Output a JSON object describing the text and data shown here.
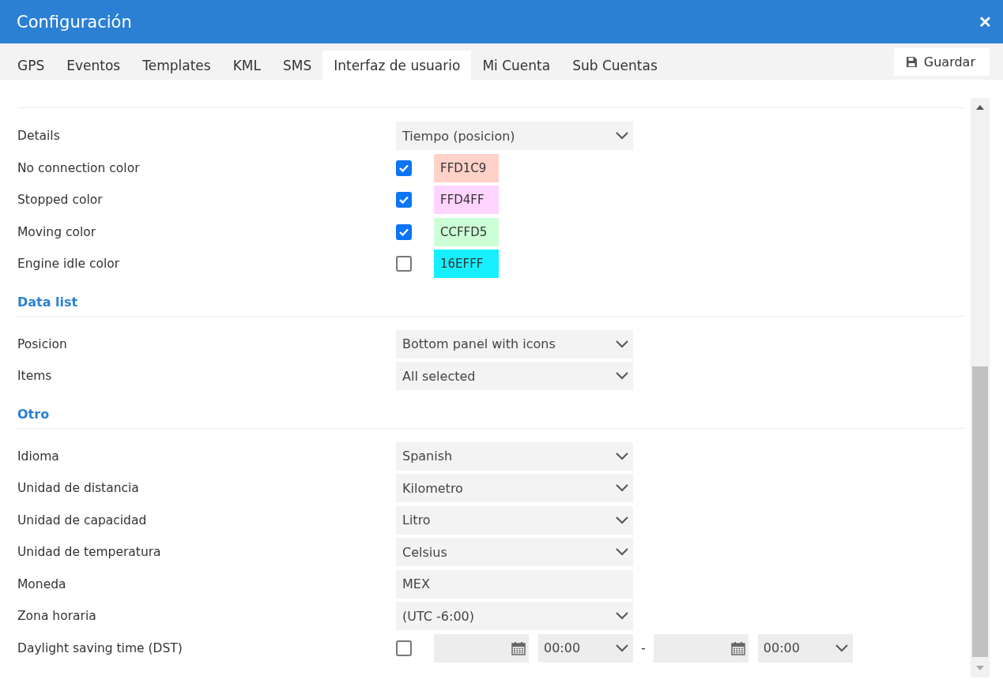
{
  "window": {
    "title": "Configuración",
    "close": "✕"
  },
  "tabs": [
    {
      "label": "GPS",
      "selected": false
    },
    {
      "label": "Eventos",
      "selected": false
    },
    {
      "label": "Templates",
      "selected": false
    },
    {
      "label": "KML",
      "selected": false
    },
    {
      "label": "SMS",
      "selected": false
    },
    {
      "label": "Interfaz de usuario",
      "selected": true
    },
    {
      "label": "Mi Cuenta",
      "selected": false
    },
    {
      "label": "Sub Cuentas",
      "selected": false
    }
  ],
  "save_button": {
    "label": "Guardar"
  },
  "sections": [
    {
      "rows": [
        {
          "kind": "select",
          "label": "Details",
          "value": "Tiempo (posicion)"
        },
        {
          "kind": "color",
          "label": "No connection color",
          "checked": true,
          "value": "FFD1C9",
          "color": "#ffd1c9"
        },
        {
          "kind": "color",
          "label": "Stopped color",
          "checked": true,
          "value": "FFD4FF",
          "color": "#ffd4ff"
        },
        {
          "kind": "color",
          "label": "Moving color",
          "checked": true,
          "value": "CCFFD5",
          "color": "#ccffd5"
        },
        {
          "kind": "color",
          "label": "Engine idle color",
          "checked": false,
          "value": "16EFFF",
          "color": "#16efff"
        }
      ]
    },
    {
      "title": "Data list",
      "rows": [
        {
          "kind": "select",
          "label": "Posicion",
          "value": "Bottom panel with icons"
        },
        {
          "kind": "select",
          "label": "Items",
          "value": "All selected"
        }
      ]
    },
    {
      "title": "Otro",
      "rows": [
        {
          "kind": "select",
          "label": "Idioma",
          "value": "Spanish"
        },
        {
          "kind": "select",
          "label": "Unidad de distancia",
          "value": "Kilometro"
        },
        {
          "kind": "select",
          "label": "Unidad de capacidad",
          "value": "Litro"
        },
        {
          "kind": "select",
          "label": "Unidad de temperatura",
          "value": "Celsius"
        },
        {
          "kind": "input",
          "label": "Moneda",
          "value": "MEX"
        },
        {
          "kind": "select",
          "label": "Zona horaria",
          "value": "(UTC -6:00)"
        },
        {
          "kind": "dst",
          "label": "Daylight saving time (DST)",
          "checked": false,
          "start_time": "00:00",
          "separator": "-",
          "end_time": "00:00"
        }
      ]
    }
  ]
}
